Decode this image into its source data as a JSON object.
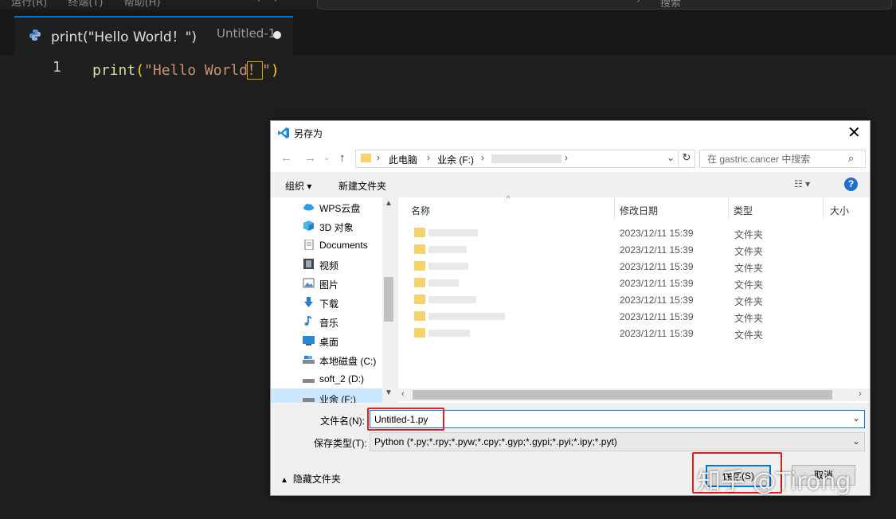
{
  "menubar": {
    "items": [
      "运行(R)",
      "终端(T)",
      "帮助(H)"
    ],
    "search_label": "搜索"
  },
  "tab": {
    "title": "print(\"Hello World！\")",
    "path": "Untitled-1"
  },
  "editor": {
    "line_number": "1",
    "fn": "print",
    "open": "(",
    "str1": "\"Hello World",
    "bang": "！",
    "str2": "\"",
    "close": ")"
  },
  "dialog": {
    "title": "另存为",
    "breadcrumb": [
      "此电脑",
      "业余 (F:)"
    ],
    "search_placeholder": "在 gastric.cancer 中搜索",
    "toolbar": {
      "organize": "组织 ▾",
      "new_folder": "新建文件夹"
    },
    "nav_items": [
      {
        "label": "WPS云盘",
        "icon": "cloud-icon"
      },
      {
        "label": "3D 对象",
        "icon": "cube-icon"
      },
      {
        "label": "Documents",
        "icon": "document-icon"
      },
      {
        "label": "视频",
        "icon": "video-icon"
      },
      {
        "label": "图片",
        "icon": "picture-icon"
      },
      {
        "label": "下载",
        "icon": "download-icon"
      },
      {
        "label": "音乐",
        "icon": "music-icon"
      },
      {
        "label": "桌面",
        "icon": "desktop-icon"
      },
      {
        "label": "本地磁盘 (C:)",
        "icon": "drive-icon"
      },
      {
        "label": "soft_2 (D:)",
        "icon": "drive-icon"
      },
      {
        "label": "业余 (F:)",
        "icon": "drive-icon"
      }
    ],
    "columns": {
      "name": "名称",
      "date": "修改日期",
      "type": "类型",
      "size": "大小"
    },
    "files": [
      {
        "date": "2023/12/11 15:39",
        "type": "文件夹"
      },
      {
        "date": "2023/12/11 15:39",
        "type": "文件夹"
      },
      {
        "date": "2023/12/11 15:39",
        "type": "文件夹"
      },
      {
        "date": "2023/12/11 15:39",
        "type": "文件夹"
      },
      {
        "date": "2023/12/11 15:39",
        "type": "文件夹"
      },
      {
        "date": "2023/12/11 15:39",
        "type": "文件夹"
      },
      {
        "date": "2023/12/11 15:39",
        "type": "文件夹"
      }
    ],
    "filename_label": "文件名(N):",
    "filename_value": "Untitled-1.py",
    "filetype_label": "保存类型(T):",
    "filetype_value": "Python (*.py;*.rpy;*.pyw;*.cpy;*.gyp;*.gypi;*.pyi;*.ipy;*.pyt)",
    "hide_folders": "隐藏文件夹",
    "save_button": "保存(S)",
    "cancel_button": "取消"
  },
  "watermark": "知乎 @Tirong",
  "colors": {
    "accent": "#0078d4",
    "highlight_box": "#e02020",
    "folder": "#f5d36c"
  }
}
